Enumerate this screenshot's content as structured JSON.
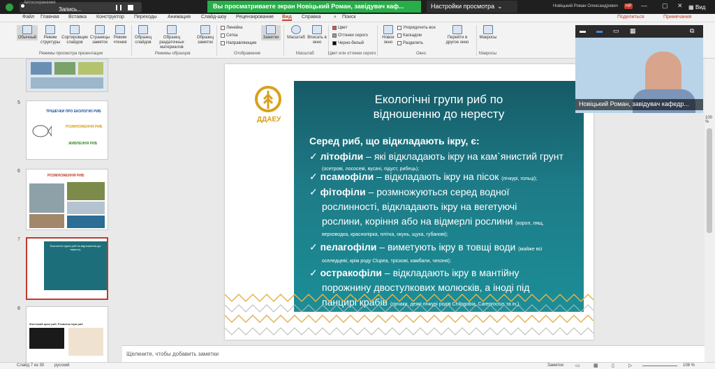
{
  "window": {
    "autosave_label": "Автосохранение",
    "rec_label": "Запись...",
    "share_banner": "Вы просматриваете экран Новіцький Роман, завідувач каф...",
    "view_options": "Настройки просмотра",
    "user_name": "Новіцький Роман Олександрович",
    "user_initials": "НР",
    "view_label": "Вид"
  },
  "menu": {
    "items": [
      "Файл",
      "Главная",
      "Вставка",
      "Конструктор",
      "Переходы",
      "Анимация",
      "Слайд-шоу",
      "Рецензирование",
      "Вид",
      "Справка",
      "Поиск"
    ],
    "share": "Поделиться",
    "notes": "Примечания"
  },
  "ribbon": {
    "buttons": [
      "Обычный",
      "Режим структуры",
      "Сортировщик слайдов",
      "Страницы заметок",
      "Режим чтения",
      "Образец слайдов",
      "Образец раздаточных материалов",
      "Образец заметок",
      "Заметки",
      "Масштаб",
      "Вписать в окно",
      "Новое окно",
      "Перейти в другое окно",
      "Макросы"
    ],
    "checkboxes": [
      "Линейка",
      "Сетка",
      "Направляющие"
    ],
    "color_options": [
      "Цвет",
      "Оттенки серого",
      "Черно-белый"
    ],
    "window_options": [
      "Упорядочить все",
      "Каскадом",
      "Разделить"
    ],
    "groups": [
      "Режимы просмотра презентации",
      "Режимы образцов",
      "Отображение",
      "Масштаб",
      "Цвет или оттенки серого",
      "Окно",
      "Макросы"
    ]
  },
  "thumbnails": [
    {
      "num": "5",
      "title": "ТРІШЕЧКИ ПРО ЕКОЛОГІЮ РИБ",
      "l1": "РОЗМНОЖЕННЯ РИБ",
      "l2": "ЖИВЛЕННЯ РИБ"
    },
    {
      "num": "6",
      "title": "РОЗМНОЖЕННЯ РИБ"
    },
    {
      "num": "7",
      "title": "Екологічні групи риб по відношенню до нересту"
    },
    {
      "num": "8",
      "title": "Життєвий цикл риб. Розвиток ікри риб"
    }
  ],
  "slide": {
    "logo_text": "ДДАЕУ",
    "title": "Екологічні групи риб по відношенню до нересту",
    "intro": "Серед риб, що відкладають ікру, є:",
    "items": [
      {
        "term": "літофіли",
        "text": " – які відкладають ікру на кам`янистий грунт",
        "note": "(осетрові, лососеві, вусачі, підуст, рибець);"
      },
      {
        "term": "псамофіли",
        "text": " – відкладають ікру на пісок",
        "note": "(пічкурі, гольці);"
      },
      {
        "term": "фітофіли",
        "text": " – розмножуються серед водної",
        "text2": "рослинності, відкладають ікру на вегетуючі",
        "text3": "рослини, коріння або на відмерлі рослини",
        "note": "(короп, лящ,",
        "note2": "верховодка, краснопірка, плітка, окунь, щука, губанові);"
      },
      {
        "term": "пелагофіли",
        "text": " – виметують ікру в товщі води",
        "note": "(майже всі",
        "note2": "оселедцеві, крім роду Clupea, тріскові, камбали, чехоня);"
      },
      {
        "term": "остракофіли",
        "text": " – відкладають ікру в мантійну",
        "text2": "порожнину двостулкових молюсків, а іноді під",
        "text3": "панцирі крабів",
        "note": "(гірчаки, деякі пічкурі родів Chilogobia, Careproctus та ін.)."
      }
    ]
  },
  "notes_placeholder": "Щелкните, чтобы добавить заметки",
  "status": {
    "slide": "Слайд 7 из 30",
    "lang": "русский",
    "notes": "Заметки",
    "zoom": "108 %"
  },
  "video": {
    "caption": "Новіцький Роман, завідувач кафедр..."
  },
  "scroll_zoom": "100 %"
}
